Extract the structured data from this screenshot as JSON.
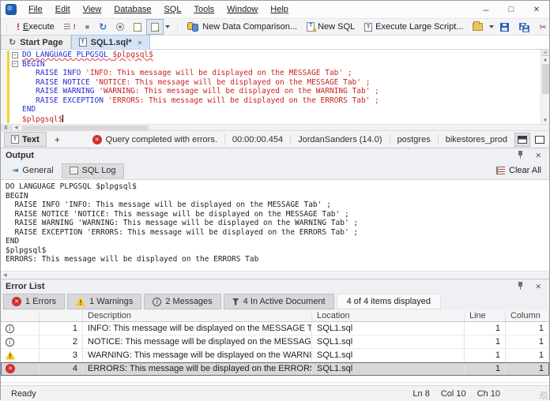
{
  "window": {
    "menu_items": [
      "File",
      "Edit",
      "View",
      "Database",
      "SQL",
      "Tools",
      "Window",
      "Help"
    ]
  },
  "toolbar": {
    "execute": "Execute",
    "new_data_comparison": "New Data Comparison...",
    "new_sql": "New SQL",
    "execute_large_script": "Execute Large Script..."
  },
  "document_tabs": [
    {
      "label": "Start Page",
      "icon": "start-page-icon",
      "active": false,
      "closable": false
    },
    {
      "label": "SQL1.sql*",
      "icon": "sql-file-icon",
      "active": true,
      "closable": true
    }
  ],
  "editor": {
    "lines": [
      {
        "fold": true,
        "segments": [
          {
            "t": "DO LANGUAGE PLPGSQL ",
            "c": "kw",
            "sq": true
          },
          {
            "t": "$plpgsql$",
            "c": "str",
            "sq": true
          }
        ]
      },
      {
        "fold": true,
        "segments": [
          {
            "t": "BEGIN",
            "c": "kw"
          }
        ]
      },
      {
        "segments": [
          {
            "t": "   ",
            "c": "pl"
          },
          {
            "t": "RAISE INFO ",
            "c": "kw"
          },
          {
            "t": "'INFO: This message will be displayed on the MESSAGE Tab'",
            "c": "str"
          },
          {
            "t": " ;",
            "c": "str"
          }
        ]
      },
      {
        "segments": [
          {
            "t": "   ",
            "c": "pl"
          },
          {
            "t": "RAISE NOTICE ",
            "c": "kw"
          },
          {
            "t": "'NOTICE: This message will be displayed on the MESSAGE Tab'",
            "c": "str"
          },
          {
            "t": " ;",
            "c": "str"
          }
        ]
      },
      {
        "segments": [
          {
            "t": "   ",
            "c": "pl"
          },
          {
            "t": "RAISE WARNING ",
            "c": "kw"
          },
          {
            "t": "'WARNING: This message will be displayed on the WARNING Tab'",
            "c": "str"
          },
          {
            "t": " ;",
            "c": "str"
          }
        ]
      },
      {
        "segments": [
          {
            "t": "   ",
            "c": "pl"
          },
          {
            "t": "RAISE EXCEPTION ",
            "c": "kw"
          },
          {
            "t": "'ERRORS: This message will be displayed on the ERRORS Tab'",
            "c": "str"
          },
          {
            "t": " ;",
            "c": "str"
          }
        ]
      },
      {
        "segments": [
          {
            "t": "END",
            "c": "kw"
          }
        ]
      },
      {
        "cursor": true,
        "segments": [
          {
            "t": "$plpgsql$",
            "c": "str"
          }
        ]
      }
    ]
  },
  "document_bar": {
    "text_tab": "Text",
    "add_tab": "+",
    "status": "Query completed with errors.",
    "duration": "00:00:00.454",
    "connection": "JordanSanders (14.0)",
    "user": "postgres",
    "database": "bikestores_prod"
  },
  "output": {
    "title": "Output",
    "tabs": [
      {
        "label": "General",
        "icon": "general",
        "active": false
      },
      {
        "label": "SQL Log",
        "icon": "sqllog",
        "active": true
      }
    ],
    "clear_all": "Clear All",
    "lines": [
      "DO LANGUAGE PLPGSQL $plpgsql$",
      "BEGIN",
      "  RAISE INFO 'INFO: This message will be displayed on the MESSAGE Tab' ;",
      "  RAISE NOTICE 'NOTICE: This message will be displayed on the MESSAGE Tab' ;",
      "  RAISE WARNING 'WARNING: This message will be displayed on the WARNING Tab' ;",
      "  RAISE EXCEPTION 'ERRORS: This message will be displayed on the ERRORS Tab' ;",
      "END",
      "$plpgsql$",
      "ERRORS: This message will be displayed on the ERRORS Tab"
    ]
  },
  "error_list": {
    "title": "Error List",
    "filters": [
      {
        "icon": "error",
        "label": "1 Errors"
      },
      {
        "icon": "warning",
        "label": "1 Warnings"
      },
      {
        "icon": "message",
        "label": "2 Messages"
      },
      {
        "icon": "filter",
        "label": "4 In Active Document"
      }
    ],
    "summary": "4 of 4 items displayed",
    "columns": [
      "Description",
      "Location",
      "Line",
      "Column"
    ],
    "rows": [
      {
        "icon": "info",
        "num": "1",
        "description": "INFO: This message will be displayed on the MESSAGE Tab",
        "location": "SQL1.sql",
        "line": "1",
        "column": "1",
        "selected": false
      },
      {
        "icon": "info",
        "num": "2",
        "description": "NOTICE: This message will be displayed on the MESSAGE Tab",
        "location": "SQL1.sql",
        "line": "1",
        "column": "1",
        "selected": false
      },
      {
        "icon": "warning",
        "num": "3",
        "description": "WARNING: This message will be displayed on the WARNING Tab",
        "location": "SQL1.sql",
        "line": "1",
        "column": "1",
        "selected": false
      },
      {
        "icon": "error",
        "num": "4",
        "description": "ERRORS: This message will be displayed on the ERRORS Tab",
        "location": "SQL1.sql",
        "line": "1",
        "column": "1",
        "selected": true
      }
    ]
  },
  "status_bar": {
    "ready": "Ready",
    "ln": "Ln 8",
    "col": "Col 10",
    "ch": "Ch 10"
  },
  "colors": {
    "accent": "#2a72c3",
    "error": "#d12f2f",
    "warning": "#fdc617",
    "keyword": "#2b2bd4",
    "string": "#cc2222",
    "active_tab": "#d5e3f6"
  }
}
